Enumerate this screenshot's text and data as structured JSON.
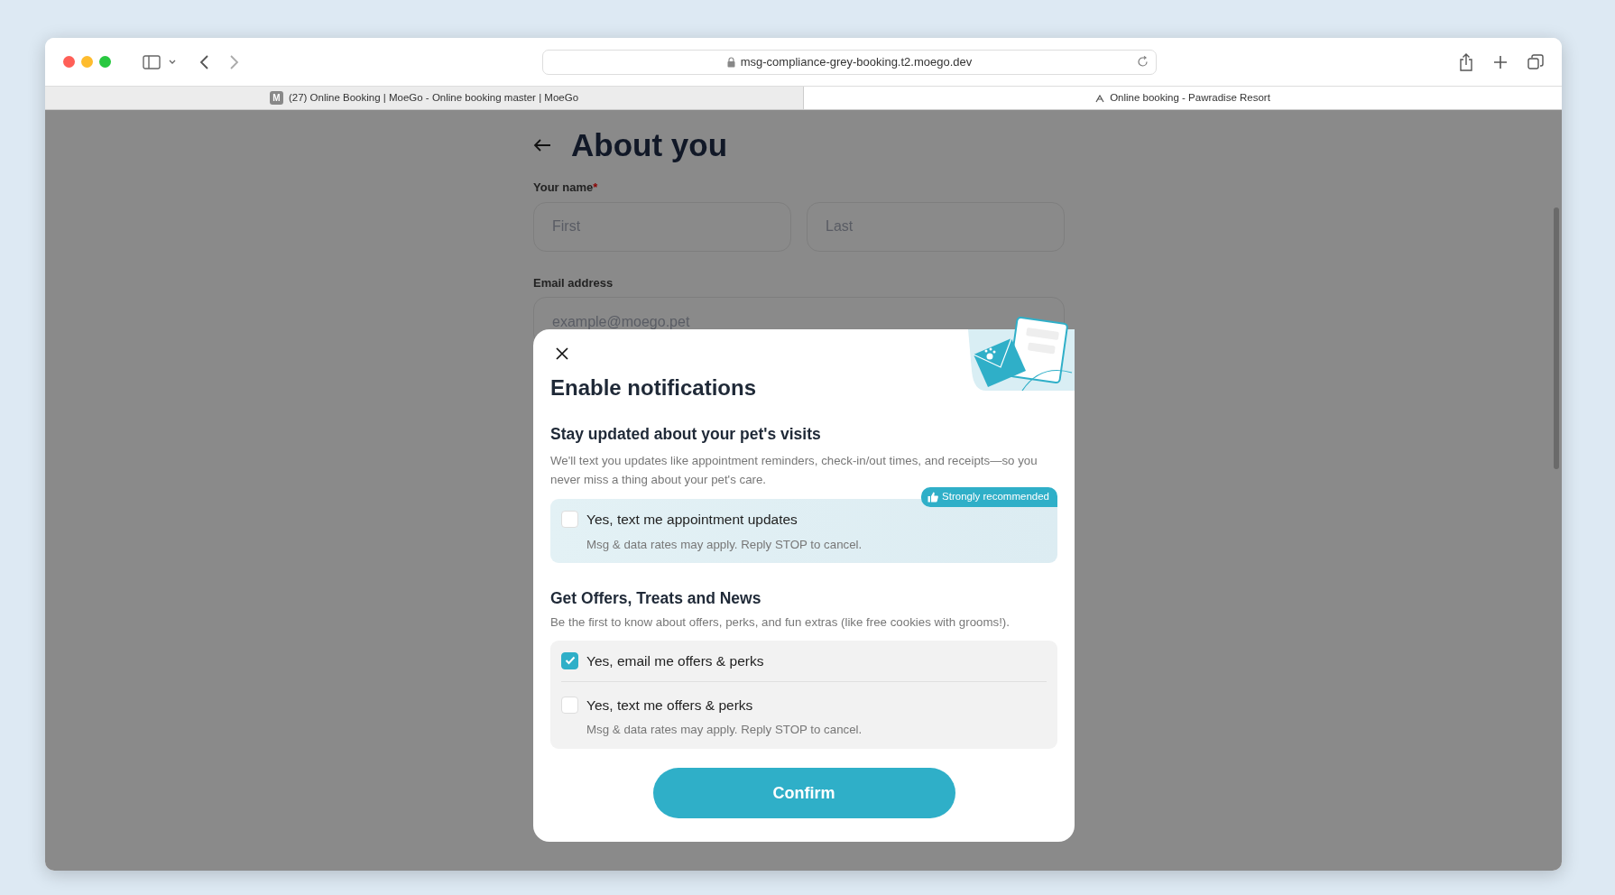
{
  "browser": {
    "url": "msg-compliance-grey-booking.t2.moego.dev",
    "tabs": [
      {
        "favicon": "M",
        "title": "(27) Online Booking | MoeGo - Online booking master | MoeGo",
        "selected": false
      },
      {
        "title": "Online booking - Pawradise Resort",
        "selected": true
      }
    ]
  },
  "page": {
    "title": "About you",
    "name_label": "Your name",
    "required_mark": "*",
    "name_fields": [
      {
        "placeholder": "First"
      },
      {
        "placeholder": "Last"
      }
    ],
    "email_label": "Email address",
    "email_field": {
      "placeholder": "example@moego.pet"
    }
  },
  "modal": {
    "title": "Enable notifications",
    "sections": [
      {
        "heading": "Stay updated about your pet's visits",
        "description": "We'll text you updates like appointment reminders, check-in/out times, and receipts—so you never miss a thing about your pet's care.",
        "kind": "recommended",
        "badge": "Strongly recommended",
        "options": [
          {
            "label": "Yes, text me appointment updates",
            "note": "Msg & data rates may apply. Reply STOP to cancel.",
            "checked": false
          }
        ]
      },
      {
        "heading": "Get Offers, Treats and News",
        "description": "Be the first to know about offers, perks, and fun extras (like free cookies with grooms!).",
        "kind": "plain",
        "options": [
          {
            "label": "Yes, email me offers & perks",
            "checked": true
          },
          {
            "label": "Yes, text me offers & perks",
            "note": "Msg & data rates may apply. Reply STOP to cancel.",
            "checked": false
          }
        ]
      }
    ],
    "confirm": "Confirm"
  }
}
